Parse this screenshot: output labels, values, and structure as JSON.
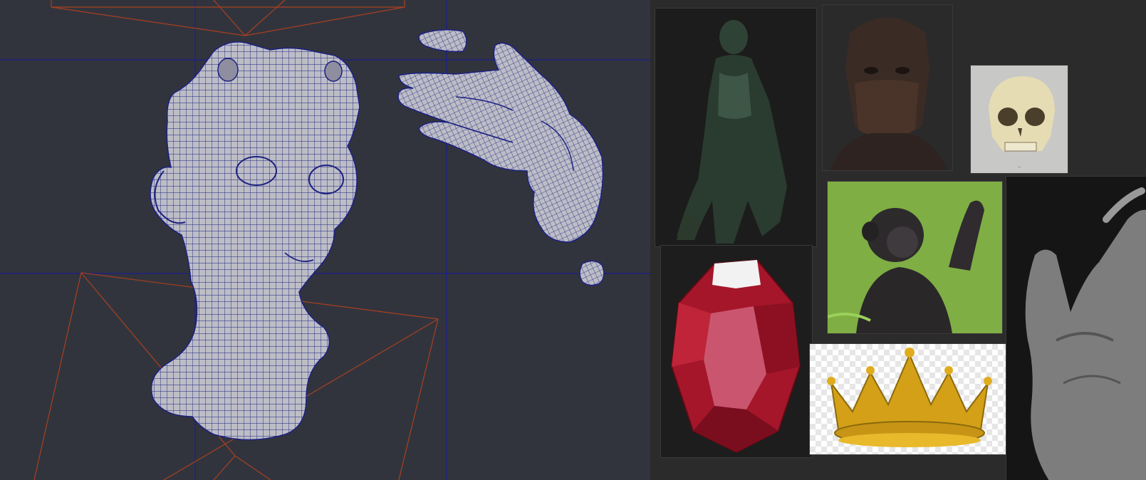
{
  "viewport": {
    "background": "#32343d",
    "grid_color": "#1b1f8c",
    "camera_frame_color": "#a8401f",
    "mesh_fill": "#bdbdc6",
    "mesh_wire": "#1c2180",
    "objects": [
      "head-mesh",
      "hand-mesh",
      "finger-fragment",
      "small-fragment"
    ]
  },
  "reference_board": {
    "background": "#2b2b2b",
    "images": [
      {
        "id": "bronze-statue",
        "kind": "photo"
      },
      {
        "id": "bronze-bust",
        "kind": "photo"
      },
      {
        "id": "skull",
        "kind": "photo",
        "caption": "..."
      },
      {
        "id": "red-gem",
        "kind": "render"
      },
      {
        "id": "bonobo",
        "kind": "photo"
      },
      {
        "id": "gold-crown",
        "kind": "clipart"
      },
      {
        "id": "bw-hand",
        "kind": "photo"
      }
    ]
  }
}
